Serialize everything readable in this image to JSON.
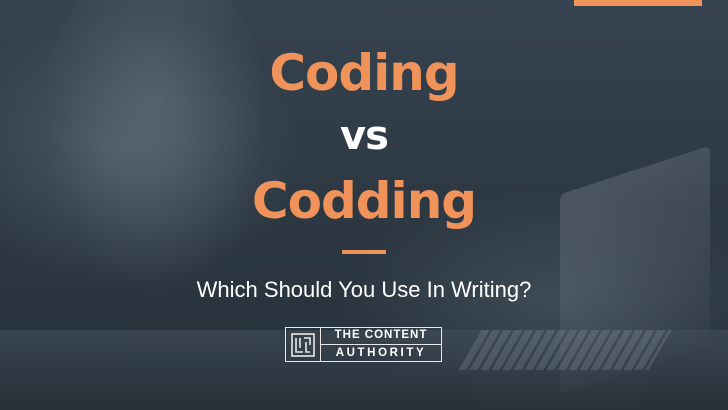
{
  "title": {
    "word1": "Coding",
    "versus": "vs",
    "word2": "Codding"
  },
  "subtitle": "Which Should You Use In Writing?",
  "logo": {
    "line1": "THE CONTENT",
    "line2": "AUTHORITY",
    "icon": "maze-logo-icon"
  },
  "colors": {
    "accent": "#f0935a",
    "background": "#2f3a44",
    "text": "#ffffff"
  }
}
